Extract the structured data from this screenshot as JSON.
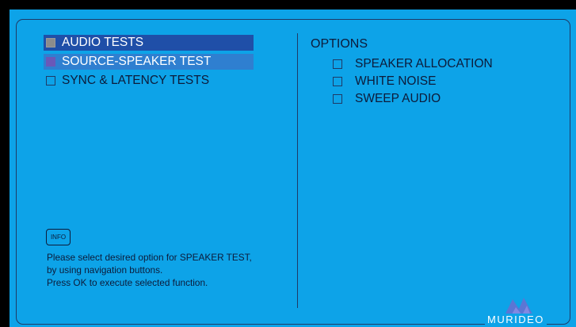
{
  "menu": {
    "items": [
      {
        "label": "AUDIO TESTS"
      },
      {
        "label": "SOURCE-SPEAKER TEST"
      },
      {
        "label": "SYNC & LATENCY TESTS"
      }
    ]
  },
  "options": {
    "title": "OPTIONS",
    "items": [
      {
        "label": "SPEAKER ALLOCATION"
      },
      {
        "label": "WHITE NOISE"
      },
      {
        "label": "SWEEP AUDIO"
      }
    ]
  },
  "info": {
    "button_label": "INFO",
    "lines": [
      "Please select desired option for SPEAKER TEST,",
      "by using navigation buttons.",
      "Press OK to execute selected function."
    ]
  },
  "brand": {
    "name": "MURIDEO"
  },
  "colors": {
    "background": "#0da3e8",
    "highlight_primary": "#1f4fa8",
    "highlight_secondary": "#2f7fd0",
    "text": "#0d1b3a"
  }
}
